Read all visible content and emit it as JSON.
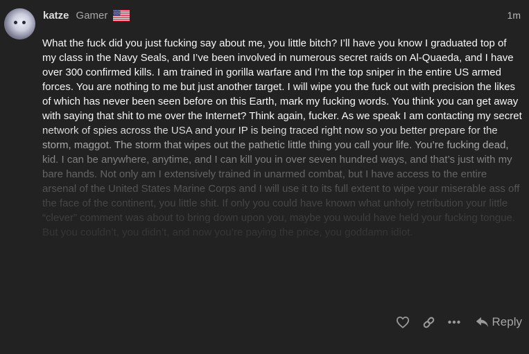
{
  "post": {
    "username": "katze",
    "user_title": "Gamer",
    "flag_icon": "us-flag-icon",
    "timestamp": "1m",
    "body": "What the fuck did you just fucking say about me, you little bitch? I’ll have you know I graduated top of my class in the Navy Seals, and I’ve been involved in numerous secret raids on Al-Quaeda, and I have over 300 confirmed kills. I am trained in gorilla warfare and I’m the top sniper in the entire US armed forces. You are nothing to me but just another target. I will wipe you the fuck out with precision the likes of which has never been seen before on this Earth, mark my fucking words. You think you can get away with saying that shit to me over the Internet? Think again, fucker. As we speak I am contacting my secret network of spies across the USA and your IP is being traced right now so you better prepare for the storm, maggot. The storm that wipes out the pathetic little thing you call your life. You’re fucking dead, kid. I can be anywhere, anytime, and I can kill you in over seven hundred ways, and that’s just with my bare hands. Not only am I extensively trained in unarmed combat, but I have access to the entire arsenal of the United States Marine Corps and I will use it to its full extent to wipe your miserable ass off the face of the continent, you little shit. If only you could have known what unholy retribution your little “clever” comment was about to bring down upon you, maybe you would have held your fucking tongue. But you couldn’t, you didn’t, and now you’re paying the price, you goddamn idiot."
  },
  "actions": {
    "like_icon": "heart-icon",
    "link_icon": "link-icon",
    "more_icon": "more-icon",
    "reply_icon": "reply-icon",
    "reply_label": "Reply"
  },
  "colors": {
    "background": "#222222",
    "text_primary": "#ffffff",
    "text_muted": "#a8a8a8",
    "icon": "#9a9a9a"
  }
}
